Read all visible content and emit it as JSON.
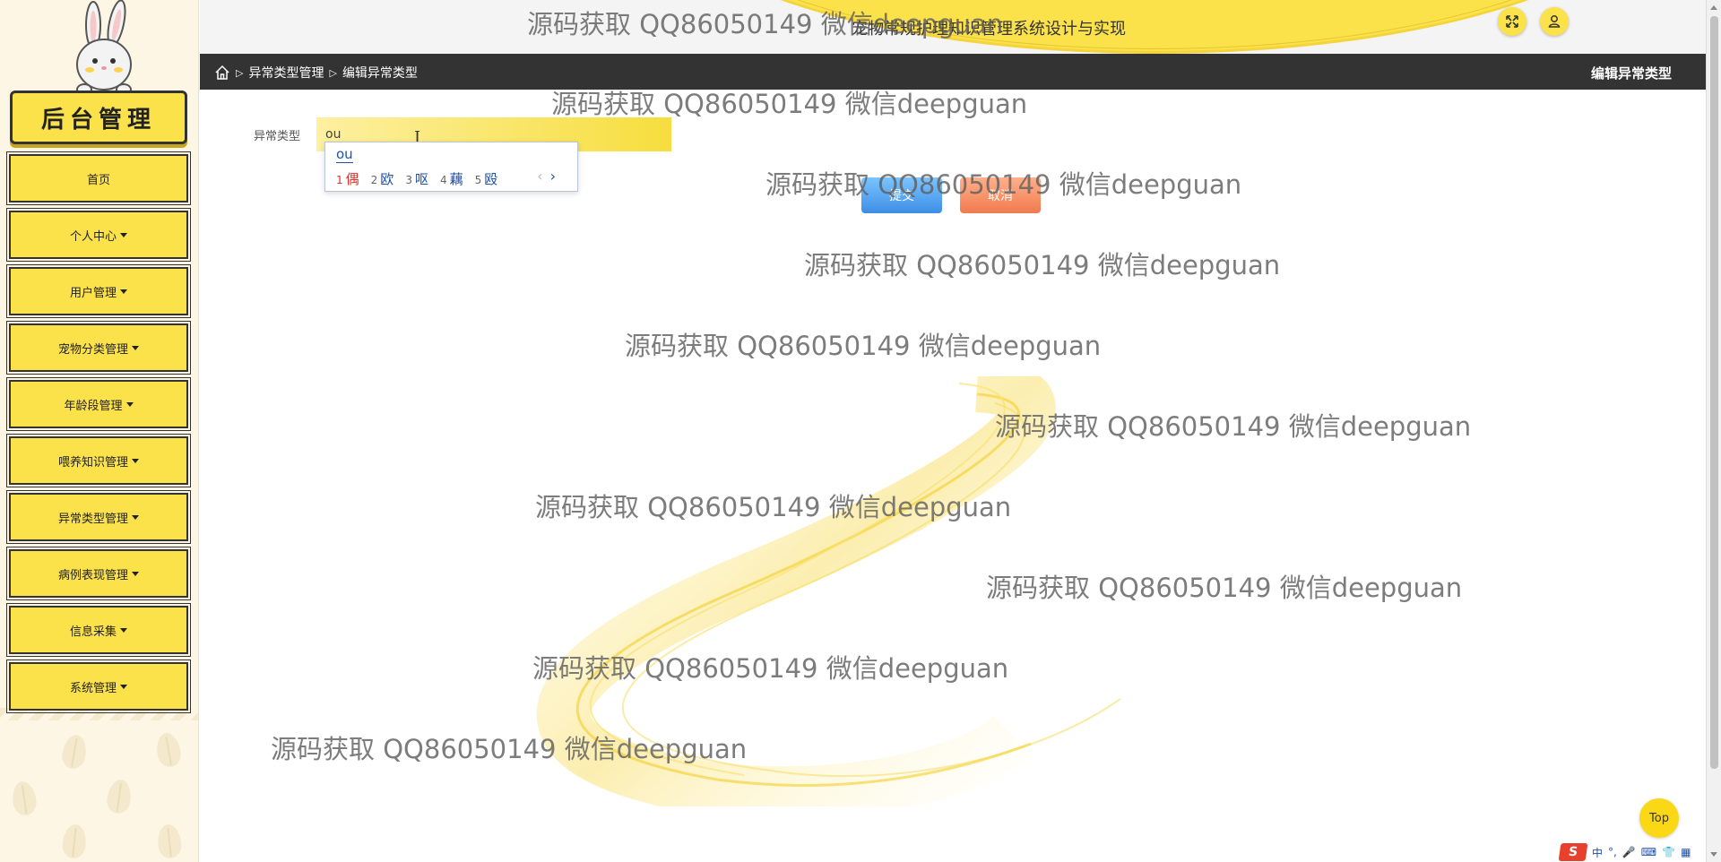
{
  "sidebar": {
    "logo_text": "后台管理",
    "menu": [
      {
        "label": "首页",
        "has_caret": false
      },
      {
        "label": "个人中心",
        "has_caret": true
      },
      {
        "label": "用户管理",
        "has_caret": true
      },
      {
        "label": "宠物分类管理",
        "has_caret": true
      },
      {
        "label": "年龄段管理",
        "has_caret": true
      },
      {
        "label": "喂养知识管理",
        "has_caret": true
      },
      {
        "label": "异常类型管理",
        "has_caret": true
      },
      {
        "label": "病例表现管理",
        "has_caret": true
      },
      {
        "label": "信息采集",
        "has_caret": true
      },
      {
        "label": "系统管理",
        "has_caret": true
      }
    ]
  },
  "header": {
    "title": "宠物常规护理知识管理系统设计与实现",
    "fullscreen_icon": "expand-icon",
    "user_icon": "user-icon"
  },
  "breadcrumb": {
    "home_icon": "home-icon",
    "items": [
      "异常类型管理",
      "编辑异常类型"
    ],
    "page_title": "编辑异常类型"
  },
  "form": {
    "label": "异常类型",
    "value": "ou",
    "submit_label": "提交",
    "cancel_label": "取消"
  },
  "ime": {
    "composition": "ou",
    "candidates": [
      {
        "num": "1",
        "char": "偶"
      },
      {
        "num": "2",
        "char": "欧"
      },
      {
        "num": "3",
        "char": "呕"
      },
      {
        "num": "4",
        "char": "藕"
      },
      {
        "num": "5",
        "char": "殴"
      }
    ],
    "prev": "‹",
    "next": "›",
    "tray_lang": "中"
  },
  "top_button": "Top",
  "watermark": "源码获取 QQ86050149 微信deepguan",
  "colors": {
    "accent": "#fbe14a",
    "dark_bar": "#333333",
    "submit": "#3d8ee6",
    "cancel": "#f17a50",
    "sidebar_bg": "#fdf6e4"
  }
}
